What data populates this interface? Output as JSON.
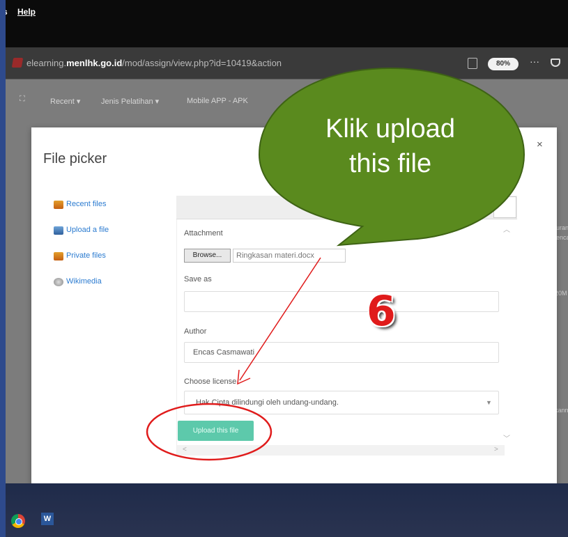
{
  "browser": {
    "menu": [
      "s",
      "Help"
    ],
    "url_prefix": "elearning.",
    "url_domain": "menlhk.go.id",
    "url_path": "/mod/assign/view.php?id=10419&action",
    "zoom": "80%",
    "more": "···"
  },
  "site_nav": {
    "items": [
      "Recent ▾",
      "Jenis Pelatihan ▾",
      "Mobile APP - APK"
    ]
  },
  "background_fragments": [
    "uran",
    "enca",
    "20M",
    "kann"
  ],
  "file_picker": {
    "title": "File picker",
    "close": "×",
    "repositories": [
      {
        "label": "Recent files",
        "icon": "recent-files-icon"
      },
      {
        "label": "Upload a file",
        "icon": "upload-icon"
      },
      {
        "label": "Private files",
        "icon": "private-files-icon"
      },
      {
        "label": "Wikimedia",
        "icon": "wikimedia-icon"
      }
    ],
    "attachment_label": "Attachment",
    "browse_label": "Browse...",
    "selected_file": "Ringkasan materi.docx",
    "save_as_label": "Save as",
    "save_as_value": "",
    "author_label": "Author",
    "author_value": "Encas  Casmawati",
    "license_label": "Choose license",
    "license_value": "Hak Cipta dilindungi oleh undang-undang.",
    "upload_button": "Upload this file"
  },
  "annotation": {
    "callout_text": "Klik upload this file",
    "step_number": "6",
    "callout_color": "#5a8a1e",
    "highlight_color": "#e01b1b"
  }
}
